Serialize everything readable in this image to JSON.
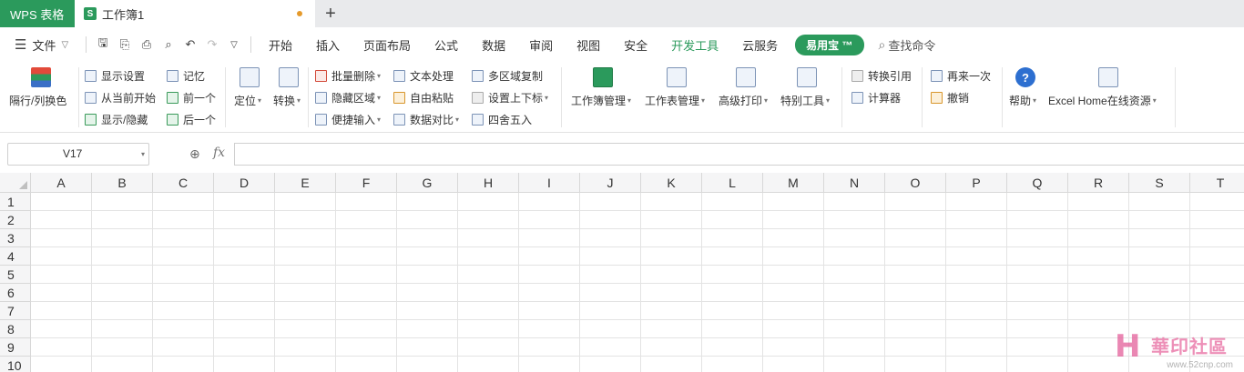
{
  "tabs": {
    "app_name": "WPS 表格",
    "doc_icon": "S",
    "doc_title": "工作簿1",
    "new_tab": "+"
  },
  "menu": {
    "file": "文件",
    "items": [
      "开始",
      "插入",
      "页面布局",
      "公式",
      "数据",
      "审阅",
      "视图",
      "安全"
    ],
    "dev_tools": "开发工具",
    "cloud": "云服务",
    "pill": "易用宝 ™",
    "search": "查找命令"
  },
  "ribbon": {
    "row_col_color": "隔行/列换色",
    "display_settings": "显示设置",
    "from_current": "从当前开始",
    "show_hide": "显示/隐藏",
    "memory": "记忆",
    "prev": "前一个",
    "next": "后一个",
    "locate": "定位",
    "convert": "转换",
    "batch_delete": "批量删除",
    "hide_region": "隐藏区域",
    "quick_input": "便捷输入",
    "text_process": "文本处理",
    "free_paste": "自由粘贴",
    "data_compare": "数据对比",
    "multi_copy": "多区域复制",
    "set_sub_sup": "设置上下标",
    "round": "四舍五入",
    "workbook_mgr": "工作簿管理",
    "sheet_mgr": "工作表管理",
    "adv_print": "高级打印",
    "special_tools": "特别工具",
    "convert_ref": "转换引用",
    "calculator": "计算器",
    "redo": "再来一次",
    "undo": "撤销",
    "help": "帮助",
    "excelhome": "Excel Home在线资源"
  },
  "formula_bar": {
    "name_box": "V17",
    "fx": "fx",
    "value": ""
  },
  "sheet": {
    "columns": [
      "A",
      "B",
      "C",
      "D",
      "E",
      "F",
      "G",
      "H",
      "I",
      "J",
      "K",
      "L",
      "M",
      "N",
      "O",
      "P",
      "Q",
      "R",
      "S",
      "T"
    ],
    "rows": [
      "1",
      "2",
      "3",
      "4",
      "5",
      "6",
      "7",
      "8",
      "9",
      "10"
    ]
  },
  "watermark": {
    "logo": "H",
    "text": "華印社區",
    "url": "www.52cnp.com"
  }
}
